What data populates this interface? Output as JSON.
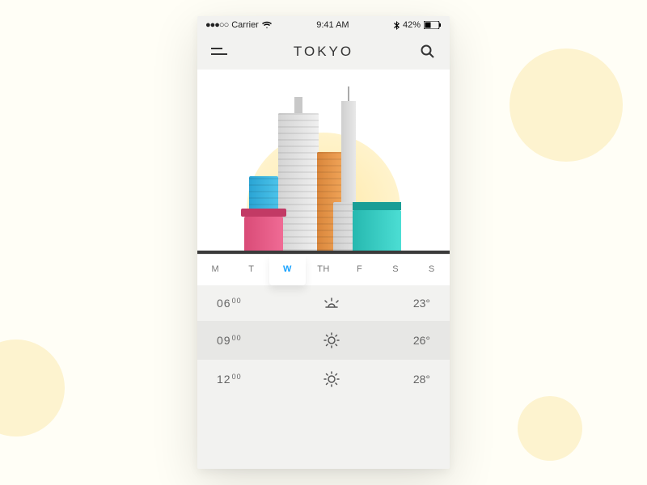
{
  "statusbar": {
    "carrier": "Carrier",
    "time": "9:41 AM",
    "battery": "42%"
  },
  "header": {
    "title": "TOKYO"
  },
  "days": [
    {
      "label": "M",
      "selected": false
    },
    {
      "label": "T",
      "selected": false
    },
    {
      "label": "W",
      "selected": true
    },
    {
      "label": "TH",
      "selected": false
    },
    {
      "label": "F",
      "selected": false
    },
    {
      "label": "S",
      "selected": false
    },
    {
      "label": "S",
      "selected": false
    }
  ],
  "hours": [
    {
      "hour": "06",
      "mins": "00",
      "icon": "sunrise",
      "temp": "23°",
      "active": false
    },
    {
      "hour": "09",
      "mins": "00",
      "icon": "sun",
      "temp": "26°",
      "active": true
    },
    {
      "hour": "12",
      "mins": "00",
      "icon": "sun",
      "temp": "28°",
      "active": false
    }
  ]
}
